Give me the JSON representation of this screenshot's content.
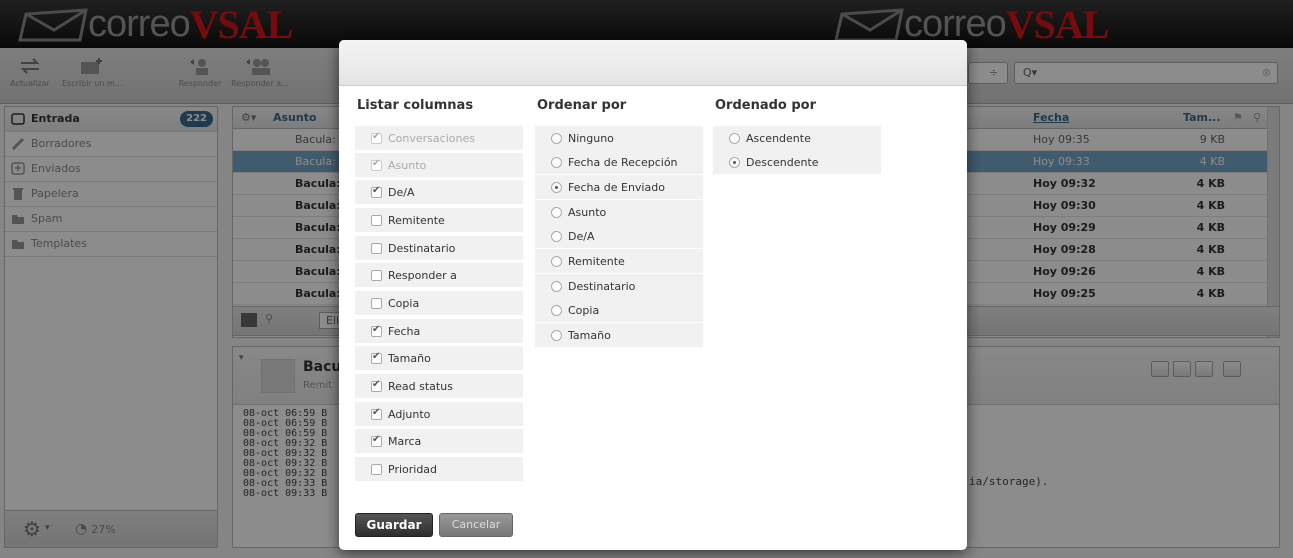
{
  "header": {
    "brand_part1": "correo",
    "brand_part2": "VSAL"
  },
  "toolbar": {
    "refresh_label": "Actualizar",
    "compose_label": "Escribir un m...",
    "reply_label": "Responder",
    "reply_all_label": "Responder a...",
    "search_placeholder": "Q▾"
  },
  "sidebar": {
    "items": [
      {
        "label": "Entrada",
        "count": "222"
      },
      {
        "label": "Borradores"
      },
      {
        "label": "Enviados"
      },
      {
        "label": "Papelera"
      },
      {
        "label": "Spam"
      },
      {
        "label": "Templates"
      }
    ],
    "quota": "27%"
  },
  "message_list": {
    "col_subject": "Asunto",
    "col_date": "Fecha",
    "col_size": "Tam...",
    "rows": [
      {
        "subject": "Bacula:",
        "date": "Hoy 09:35",
        "size": "9 KB"
      },
      {
        "subject": "Bacula:",
        "date": "Hoy 09:33",
        "size": "4 KB"
      },
      {
        "subject": "Bacula:",
        "date": "Hoy 09:32",
        "size": "4 KB"
      },
      {
        "subject": "Bacula:",
        "date": "Hoy 09:30",
        "size": "4 KB"
      },
      {
        "subject": "Bacula:",
        "date": "Hoy 09:29",
        "size": "4 KB"
      },
      {
        "subject": "Bacula:",
        "date": "Hoy 09:28",
        "size": "4 KB"
      },
      {
        "subject": "Bacula:",
        "date": "Hoy 09:26",
        "size": "4 KB"
      },
      {
        "subject": "Bacula:",
        "date": "Hoy 09:25",
        "size": "4 KB"
      }
    ],
    "footer_select": "Eli"
  },
  "preview": {
    "subject": "Bacu",
    "from": "Remit",
    "body": "08-oct 06:59 B\n08-oct 06:59 B\n08-oct 06:59 B\n08-oct 09:32 B\n08-oct 09:32 B\n08-oct 09:32 B\n08-oct 09:32 B\n08-oct 09:33 B\n08-oct 09:33 B",
    "tail": "ia/storage)."
  },
  "dialog": {
    "list_columns_title": "Listar columnas",
    "sort_by_title": "Ordenar por",
    "order_title": "Ordenado por",
    "columns": [
      {
        "label": "Conversaciones",
        "checked": true,
        "disabled": true
      },
      {
        "label": "Asunto",
        "checked": true,
        "disabled": true
      },
      {
        "label": "De/A",
        "checked": true,
        "disabled": false
      },
      {
        "label": "Remitente",
        "checked": false,
        "disabled": false
      },
      {
        "label": "Destinatario",
        "checked": false,
        "disabled": false
      },
      {
        "label": "Responder a",
        "checked": false,
        "disabled": false
      },
      {
        "label": "Copia",
        "checked": false,
        "disabled": false
      },
      {
        "label": "Fecha",
        "checked": true,
        "disabled": false
      },
      {
        "label": "Tamaño",
        "checked": true,
        "disabled": false
      },
      {
        "label": "Read status",
        "checked": true,
        "disabled": false
      },
      {
        "label": "Adjunto",
        "checked": true,
        "disabled": false
      },
      {
        "label": "Marca",
        "checked": true,
        "disabled": false
      },
      {
        "label": "Prioridad",
        "checked": false,
        "disabled": false
      }
    ],
    "sort_options": [
      {
        "label": "Ninguno",
        "selected": false
      },
      {
        "label": "Fecha de Recepción",
        "selected": false
      },
      {
        "label": "Fecha de Enviado",
        "selected": true
      },
      {
        "label": "Asunto",
        "selected": false
      },
      {
        "label": "De/A",
        "selected": false
      },
      {
        "label": "Remitente",
        "selected": false
      },
      {
        "label": "Destinatario",
        "selected": false
      },
      {
        "label": "Copia",
        "selected": false
      },
      {
        "label": "Tamaño",
        "selected": false
      }
    ],
    "order_options": [
      {
        "label": "Ascendente",
        "selected": false
      },
      {
        "label": "Descendente",
        "selected": true
      }
    ],
    "save_label": "Guardar",
    "cancel_label": "Cancelar"
  }
}
